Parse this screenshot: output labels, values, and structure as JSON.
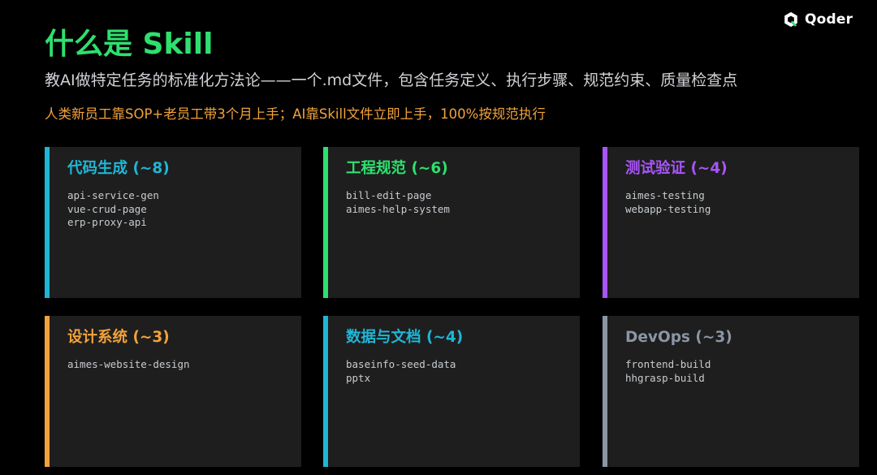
{
  "brand": {
    "name": "Qoder",
    "accent_color": "#2ee06e",
    "icon": "qoder-logo-icon"
  },
  "title": "什么是 Skill",
  "subtitle": "教AI做特定任务的标准化方法论——一个.md文件，包含任务定义、执行步骤、规范约束、质量检查点",
  "highlight": "人类新员工靠SOP+老员工带3个月上手；AI靠Skill文件立即上手，100%按规范执行",
  "cards": [
    {
      "title": "代码生成 (~8)",
      "color": "#1fb6d6",
      "items": [
        "api-service-gen",
        "vue-crud-page",
        "erp-proxy-api"
      ]
    },
    {
      "title": "工程规范 (~6)",
      "color": "#2ee06e",
      "items": [
        "bill-edit-page",
        "aimes-help-system"
      ]
    },
    {
      "title": "测试验证 (~4)",
      "color": "#a855f7",
      "items": [
        "aimes-testing",
        "webapp-testing"
      ]
    },
    {
      "title": "设计系统 (~3)",
      "color": "#f2a23a",
      "items": [
        "aimes-website-design"
      ]
    },
    {
      "title": "数据与文档 (~4)",
      "color": "#1fb6d6",
      "items": [
        "baseinfo-seed-data",
        "pptx"
      ]
    },
    {
      "title": "DevOps (~3)",
      "color": "#8a96a3",
      "items": [
        "frontend-build",
        "hhgrasp-build"
      ]
    }
  ]
}
